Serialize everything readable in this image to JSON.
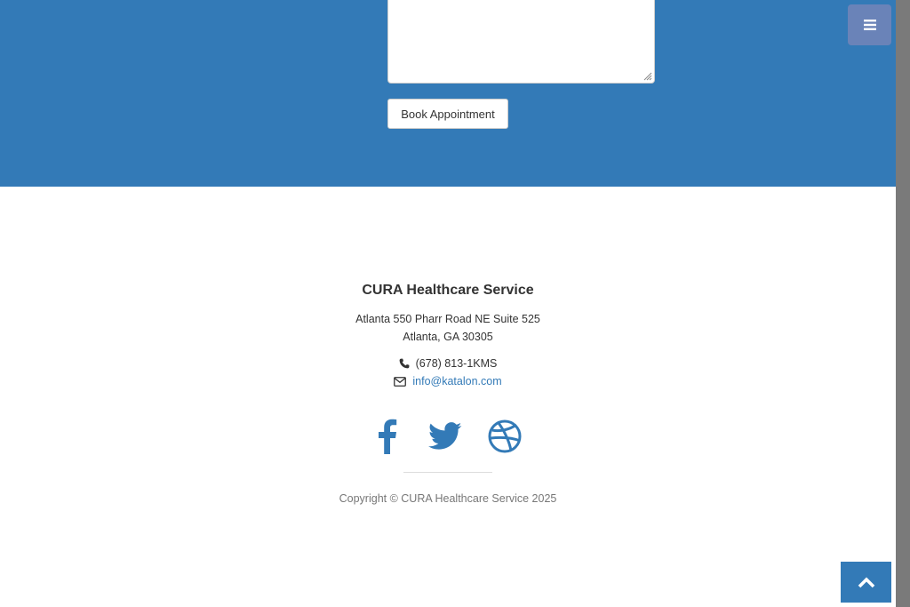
{
  "appointment_form": {
    "comment_value": "",
    "book_button_label": "Book Appointment"
  },
  "nav": {
    "menu_icon": "bars-icon"
  },
  "footer": {
    "title": "CURA Healthcare Service",
    "address_line1": "Atlanta 550 Pharr Road NE Suite 525",
    "address_line2": "Atlanta, GA 30305",
    "phone": "(678) 813-1KMS",
    "email": "info@katalon.com",
    "social": [
      {
        "name": "facebook",
        "icon": "facebook-icon"
      },
      {
        "name": "twitter",
        "icon": "twitter-icon"
      },
      {
        "name": "dribbble",
        "icon": "dribbble-icon"
      }
    ],
    "copyright": "Copyright © CURA Healthcare Service 2025"
  },
  "to_top": {
    "icon": "chevron-up-icon"
  },
  "colors": {
    "primary": "#337ab7",
    "menu_bg": "#6a83b8",
    "scrollbar": "#7a7a7a",
    "text": "#333333",
    "muted": "#777777"
  }
}
